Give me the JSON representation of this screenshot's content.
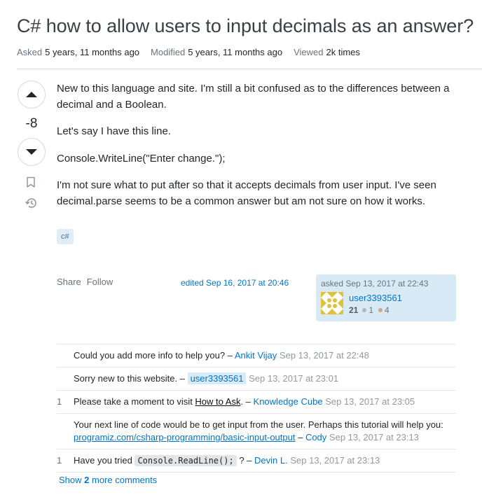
{
  "question": {
    "title": "C# how to allow users to input decimals as an answer?",
    "meta": {
      "asked_label": "Asked",
      "asked_value": "5 years, 11 months ago",
      "modified_label": "Modified",
      "modified_value": "5 years, 11 months ago",
      "viewed_label": "Viewed",
      "viewed_value": "2k times"
    },
    "vote_count": "-8",
    "body": [
      "New to this language and site. I'm still a bit confused as to the differences between a decimal and a Boolean.",
      "Let's say I have this line.",
      "Console.WriteLine(\"Enter change.\");",
      "I'm not sure what to put after so that it accepts decimals from user input. I've seen decimal.parse seems to be a common answer but am not sure on how it works."
    ],
    "tag": "c#",
    "share_label": "Share",
    "follow_label": "Follow",
    "edited": "edited Sep 16, 2017 at 20:46",
    "asked_card": {
      "time": "asked Sep 13, 2017 at 22:43",
      "user": "user3393561",
      "rep": "21",
      "silver": "1",
      "bronze": "4"
    }
  },
  "comments": [
    {
      "score": "",
      "text": "Could you add more info to help you? – ",
      "user": "Ankit Vijay",
      "time": "Sep 13, 2017 at 22:48"
    },
    {
      "score": "",
      "text": "Sorry new to this website. – ",
      "user": "user3393561",
      "time": "Sep 13, 2017 at 23:01"
    },
    {
      "score": "1",
      "text_pre": "Please take a moment to visit ",
      "link": "How to Ask",
      "text_post": ". – ",
      "user": "Knowledge Cube",
      "time": "Sep 13, 2017 at 23:05"
    },
    {
      "score": "",
      "text": "Your next line of code would be to get input from the user. Perhaps this tutorial will help you: ",
      "link": "programiz.com/csharp-programming/basic-input-output",
      "sep": " – ",
      "user": "Cody",
      "time": "Sep 13, 2017 at 23:13"
    },
    {
      "score": "1",
      "text_pre": "Have you tried ",
      "code": "Console.ReadLine();",
      "text_post": " ? – ",
      "user": "Devin L.",
      "time": "Sep 13, 2017 at 23:13"
    }
  ],
  "show_more": {
    "pre": "Show ",
    "count": "2",
    "post": " more comments"
  }
}
